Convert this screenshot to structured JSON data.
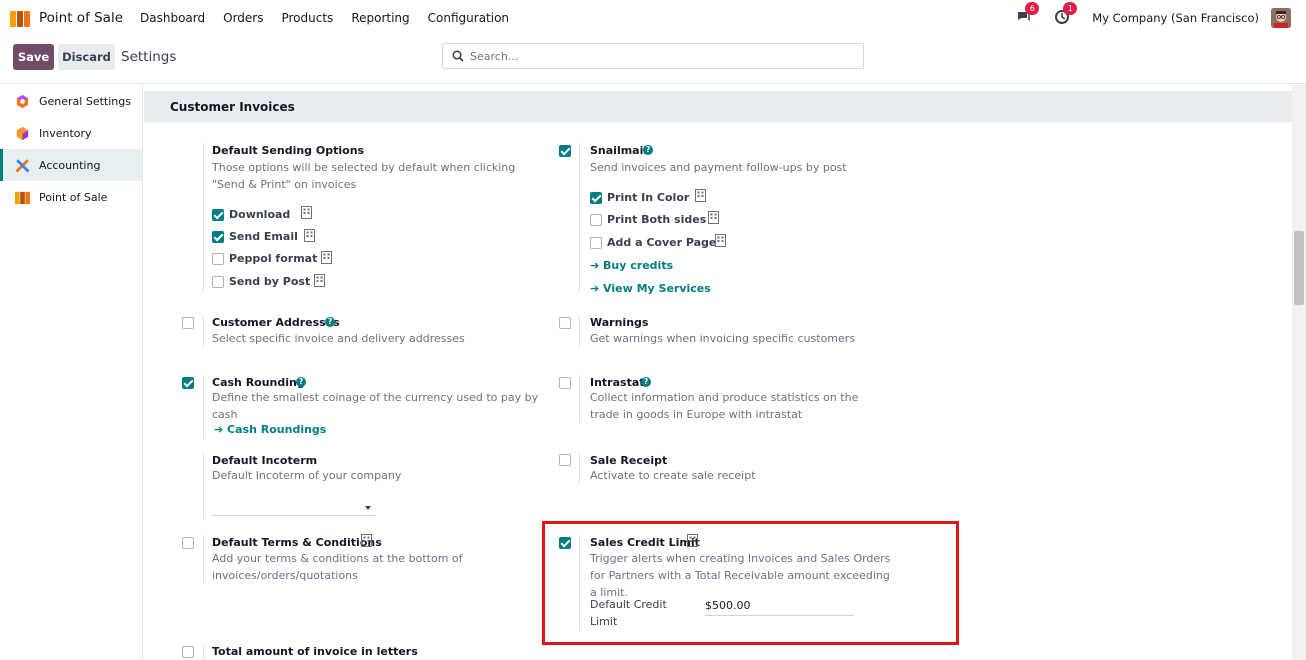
{
  "navbar": {
    "app_name": "Point of Sale",
    "menu": [
      "Dashboard",
      "Orders",
      "Products",
      "Reporting",
      "Configuration"
    ],
    "messages_badge": "6",
    "activities_badge": "1",
    "company": "My Company (San Francisco)"
  },
  "control": {
    "save_label": "Save",
    "discard_label": "Discard",
    "breadcrumb": "Settings",
    "search_placeholder": "Search..."
  },
  "sidebar": {
    "items": [
      {
        "label": "General Settings",
        "icon": "general-settings-icon"
      },
      {
        "label": "Inventory",
        "icon": "inventory-icon"
      },
      {
        "label": "Accounting",
        "icon": "accounting-icon",
        "active": true
      },
      {
        "label": "Point of Sale",
        "icon": "point-of-sale-icon"
      }
    ]
  },
  "section": {
    "title": "Customer Invoices",
    "sending": {
      "title": "Default Sending Options",
      "desc": "Those options will be selected by default when clicking \"Send & Print\" on invoices",
      "options": [
        {
          "label": "Download",
          "checked": true
        },
        {
          "label": "Send Email",
          "checked": true
        },
        {
          "label": "Peppol format",
          "checked": false
        },
        {
          "label": "Send by Post",
          "checked": false
        }
      ]
    },
    "snailmail": {
      "title": "Snailmail",
      "desc": "Send invoices and payment follow-ups by post",
      "checked": true,
      "options": [
        {
          "label": "Print In Color",
          "checked": true
        },
        {
          "label": "Print Both sides",
          "checked": false
        },
        {
          "label": "Add a Cover Page",
          "checked": false
        }
      ],
      "link_buy": "Buy credits",
      "link_services": "View My Services"
    },
    "addresses": {
      "title": "Customer Addresses",
      "desc": "Select specific invoice and delivery addresses",
      "checked": false
    },
    "warnings": {
      "title": "Warnings",
      "desc": "Get warnings when invoicing specific customers",
      "checked": false
    },
    "cash_rounding": {
      "title": "Cash Rounding",
      "desc": "Define the smallest coinage of the currency used to pay by cash",
      "checked": true,
      "link": "Cash Roundings"
    },
    "intrastat": {
      "title": "Intrastat",
      "desc": "Collect information and produce statistics on the trade in goods in Europe with intrastat",
      "checked": false
    },
    "incoterm": {
      "title": "Default Incoterm",
      "desc": "Default Incoterm of your company"
    },
    "sale_receipt": {
      "title": "Sale Receipt",
      "desc": "Activate to create sale receipt",
      "checked": false
    },
    "terms": {
      "title": "Default Terms & Conditions",
      "desc": "Add your terms & conditions at the bottom of invoices/orders/quotations",
      "checked": false
    },
    "credit_limit": {
      "title": "Sales Credit Limit",
      "desc": "Trigger alerts when creating Invoices and Sales Orders for Partners with a Total Receivable amount exceeding a limit.",
      "checked": true,
      "field_label": "Default Credit Limit",
      "field_value": "$500.00"
    },
    "letters": {
      "title": "Total amount of invoice in letters",
      "checked": false
    }
  },
  "colors": {
    "brand": "#714b67",
    "accent": "#017e84",
    "highlight": "#e01616"
  }
}
